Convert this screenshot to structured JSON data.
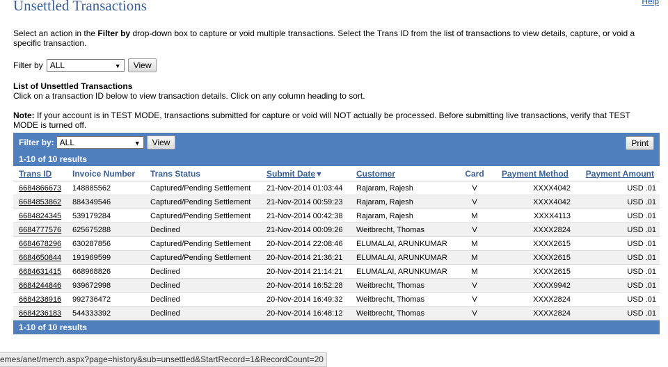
{
  "page": {
    "title": "Unsettled Transactions",
    "help": "Help",
    "intro_pre": "Select an action in the ",
    "intro_bold": "Filter by",
    "intro_post": " drop-down box to capture or void multiple transactions. Select the Trans ID from the list of transactions to view details, capture, or void a specific transaction.",
    "filter_label": "Filter by",
    "filter_value": "ALL",
    "view_button": "View",
    "list_title": "List of Unsettled Transactions",
    "list_sub": "Click on a transaction ID below to view transaction details. Click on any column heading to sort.",
    "note_label": "Note:",
    "note_text": " If your account is in TEST MODE, transactions submitted for capture or void will NOT actually be processed. Before submitting live transactions, verify that TEST MODE is turned off."
  },
  "grid": {
    "filter_label": "Filter by:",
    "filter_value": "ALL",
    "view_button": "View",
    "print_button": "Print",
    "results_top": "1-10 of 10 results",
    "results_bottom": "1-10 of 10 results",
    "columns": [
      "Trans ID",
      "Invoice Number",
      "Trans Status",
      "Submit Date",
      "Customer",
      "Card",
      "Payment Method",
      "Payment Amount"
    ],
    "rows": [
      [
        "6684866673",
        "148885562",
        "Captured/Pending Settlement",
        "21-Nov-2014 01:03:44",
        "Rajaram, Rajesh",
        "V",
        "XXXX4042",
        "USD .01"
      ],
      [
        "6684853862",
        "884349546",
        "Captured/Pending Settlement",
        "21-Nov-2014 00:59:23",
        "Rajaram, Rajesh",
        "V",
        "XXXX4042",
        "USD .01"
      ],
      [
        "6684824345",
        "539179284",
        "Captured/Pending Settlement",
        "21-Nov-2014 00:42:38",
        "Rajaram, Rajesh",
        "M",
        "XXXX4113",
        "USD .01"
      ],
      [
        "6684777576",
        "625675288",
        "Declined",
        "21-Nov-2014 00:09:26",
        "Weitbrecht, Thomas",
        "V",
        "XXXX2824",
        "USD .01"
      ],
      [
        "6684678296",
        "630287856",
        "Captured/Pending Settlement",
        "20-Nov-2014 22:08:46",
        "ELUMALAI, ARUNKUMAR",
        "M",
        "XXXX2615",
        "USD .01"
      ],
      [
        "6684650844",
        "191969599",
        "Captured/Pending Settlement",
        "20-Nov-2014 21:36:21",
        "ELUMALAI, ARUNKUMAR",
        "M",
        "XXXX2615",
        "USD .01"
      ],
      [
        "6684631415",
        "668968826",
        "Declined",
        "20-Nov-2014 21:14:21",
        "ELUMALAI, ARUNKUMAR",
        "M",
        "XXXX2615",
        "USD .01"
      ],
      [
        "6684244846",
        "939672998",
        "Declined",
        "20-Nov-2014 16:52:28",
        "Weitbrecht, Thomas",
        "V",
        "XXXX9942",
        "USD .01"
      ],
      [
        "6684238916",
        "992736472",
        "Declined",
        "20-Nov-2014 16:49:32",
        "Weitbrecht, Thomas",
        "V",
        "XXXX2824",
        "USD .01"
      ],
      [
        "6684236183",
        "544333392",
        "Declined",
        "20-Nov-2014 16:48:12",
        "Weitbrecht, Thomas",
        "V",
        "XXXX2824",
        "USD .01"
      ]
    ]
  },
  "statusbar": {
    "url": "emes/anet/merch.aspx?page=history&sub=unsettled&StartRecord=1&RecordCount=20"
  },
  "colors": {
    "header_bar": "#4f7fbd",
    "title": "#3a5f95",
    "link": "#1a57a0"
  },
  "icons": {
    "dropdown": "chevron-down-icon",
    "sort": "sort-descending-icon"
  }
}
